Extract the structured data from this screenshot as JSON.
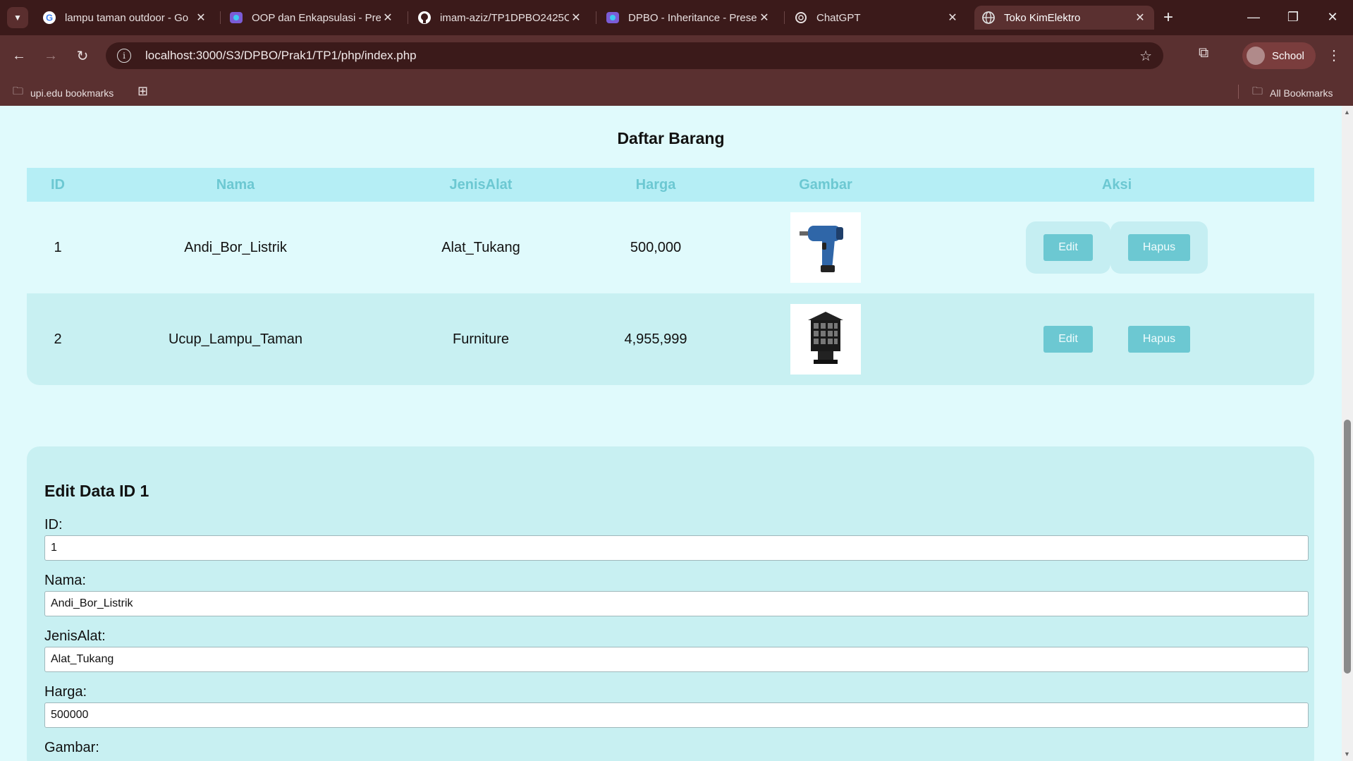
{
  "browser": {
    "tabs": [
      {
        "label": "lampu taman outdoor - Go",
        "icon": "google-icon"
      },
      {
        "label": "OOP dan Enkapsulasi - Pre",
        "icon": "slides-icon"
      },
      {
        "label": "imam-aziz/TP1DPBO2425C",
        "icon": "github-icon"
      },
      {
        "label": "DPBO - Inheritance - Prese",
        "icon": "slides-icon"
      },
      {
        "label": "ChatGPT",
        "icon": "chatgpt-icon"
      },
      {
        "label": "Toko KimElektro",
        "icon": "globe-icon",
        "active": true
      }
    ],
    "url": "localhost:3000/S3/DPBO/Prak1/TP1/php/index.php",
    "profile_label": "School",
    "bookmarks": {
      "left_folder": "upi.edu bookmarks",
      "all_bookmarks": "All Bookmarks"
    }
  },
  "page": {
    "list_title": "Daftar Barang",
    "columns": [
      "ID",
      "Nama",
      "JenisAlat",
      "Harga",
      "Gambar",
      "Aksi"
    ],
    "rows": [
      {
        "id": "1",
        "nama": "Andi_Bor_Listrik",
        "jenis": "Alat_Tukang",
        "harga": "500,000",
        "gambar": "drill-image",
        "edit": "Edit",
        "hapus": "Hapus"
      },
      {
        "id": "2",
        "nama": "Ucup_Lampu_Taman",
        "jenis": "Furniture",
        "harga": "4,955,999",
        "gambar": "garden-lamp-image",
        "edit": "Edit",
        "hapus": "Hapus"
      }
    ],
    "edit_form": {
      "title": "Edit Data ID 1",
      "id_label": "ID:",
      "id_value": "1",
      "nama_label": "Nama:",
      "nama_value": "Andi_Bor_Listrik",
      "jenis_label": "JenisAlat:",
      "jenis_value": "Alat_Tukang",
      "harga_label": "Harga:",
      "harga_value": "500000",
      "gambar_label": "Gambar:"
    }
  },
  "colors": {
    "page_bg": "#e0fafc",
    "header_bg": "#b5eef5",
    "accent": "#6cc8d2",
    "chrome_dark": "#3b1a1a",
    "chrome": "#5a3030"
  }
}
